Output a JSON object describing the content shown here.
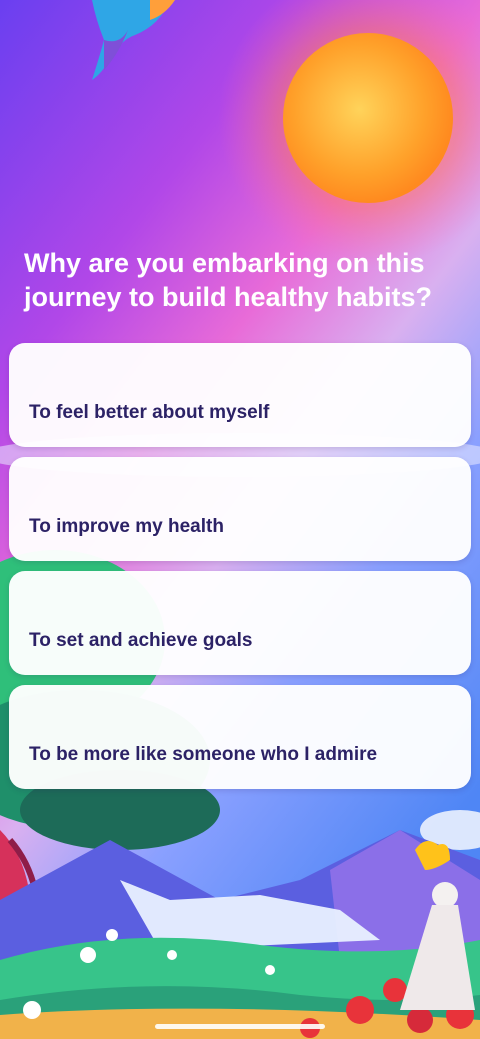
{
  "question": {
    "title": "Why are you embarking on this journey to build healthy habits?"
  },
  "options": [
    {
      "label": "To feel better about myself"
    },
    {
      "label": "To improve my health"
    },
    {
      "label": "To set and achieve goals"
    },
    {
      "label": "To be more like someone who I admire"
    }
  ],
  "illustration": {
    "elements": [
      "bird",
      "sun",
      "tree",
      "mountains",
      "clouds",
      "flowers",
      "figure"
    ]
  },
  "colors": {
    "sky_top": "#7b3fe6",
    "sky_pink": "#e36ad8",
    "sun": "#ff9a2a",
    "card": "#ffffff",
    "card_text": "#2c2266"
  }
}
